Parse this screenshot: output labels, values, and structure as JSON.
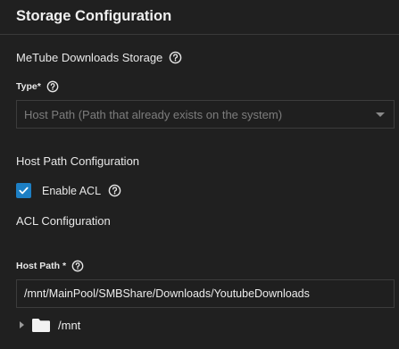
{
  "header": {
    "title": "Storage Configuration"
  },
  "metube": {
    "section_label": "MeTube Downloads Storage",
    "type_label": "Type",
    "required_mark": "*",
    "type_value": "Host Path (Path that already exists on the system)"
  },
  "host_path_config": {
    "section_label": "Host Path Configuration",
    "enable_acl_label": "Enable ACL",
    "enable_acl_checked": true
  },
  "acl": {
    "section_label": "ACL Configuration",
    "host_path_label": "Host Path",
    "required_mark": "*",
    "host_path_value": "/mnt/MainPool/SMBShare/Downloads/YoutubeDownloads"
  },
  "tree": {
    "items": [
      {
        "label": "/mnt",
        "icon": "folder-icon",
        "expanded": false
      }
    ]
  },
  "colors": {
    "background": "#202020",
    "accent": "#1d7fc4",
    "muted_text": "#7d7d7d"
  }
}
